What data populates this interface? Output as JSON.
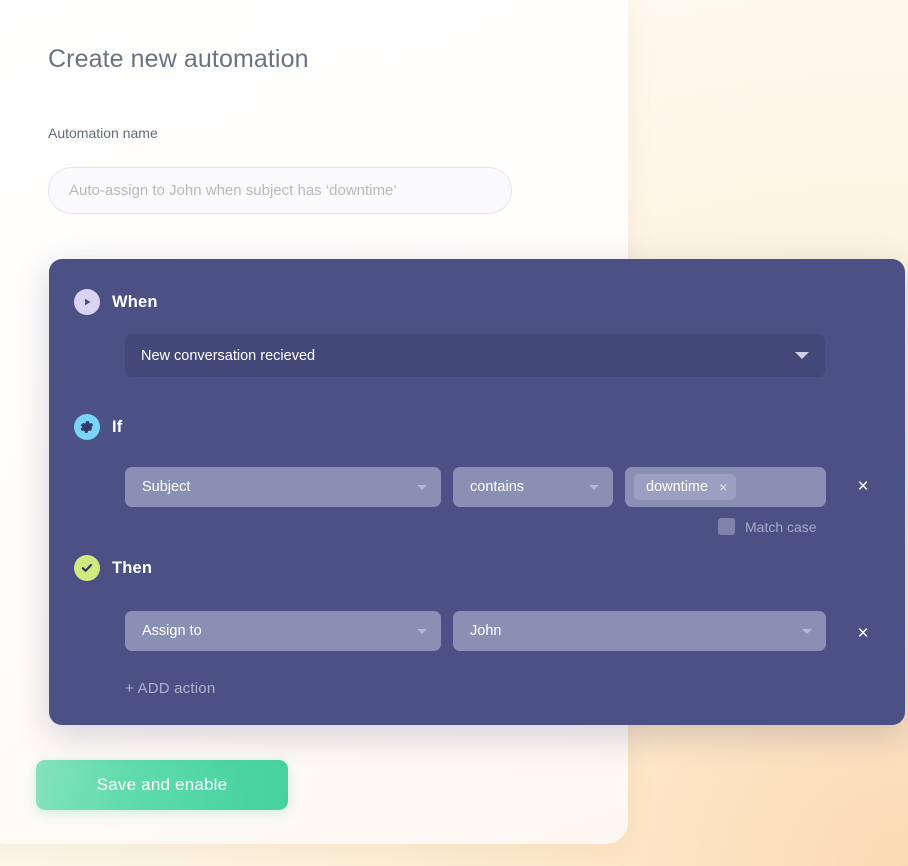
{
  "page": {
    "title": "Create new automation",
    "name_field": {
      "label": "Automation name",
      "value": "",
      "placeholder": "Auto-assign to John when subject has ‘downtime’"
    },
    "save_button": "Save and enable"
  },
  "rule": {
    "when": {
      "icon": "play-icon",
      "label": "When",
      "trigger_value": "New conversation recieved",
      "caret": "chevron-down-icon"
    },
    "if": {
      "icon": "gear-icon",
      "label": "If",
      "field_value": "Subject",
      "operator_value": "contains",
      "chip_label": "downtime",
      "chip_remove": "×",
      "delete_row": "×",
      "match_case_label": "Match case",
      "match_case_checked": false
    },
    "then": {
      "icon": "check-circle-icon",
      "label": "Then",
      "action_value": "Assign to",
      "target_value": "John",
      "delete_row": "×"
    },
    "add_action": "+ ADD action"
  },
  "colors": {
    "panel_bg": "#4b5185",
    "when_select_bg": "#424878",
    "pill_bg": "#8a8fb4",
    "chip_bg": "#9ba0c0",
    "badge_when": "#d9d4f2",
    "badge_if": "#79d5f5",
    "badge_then": "#cdeb7e",
    "save_button": "#4fd6a4",
    "page_background": "#fdf0d8",
    "card_background": "#ffffff"
  }
}
